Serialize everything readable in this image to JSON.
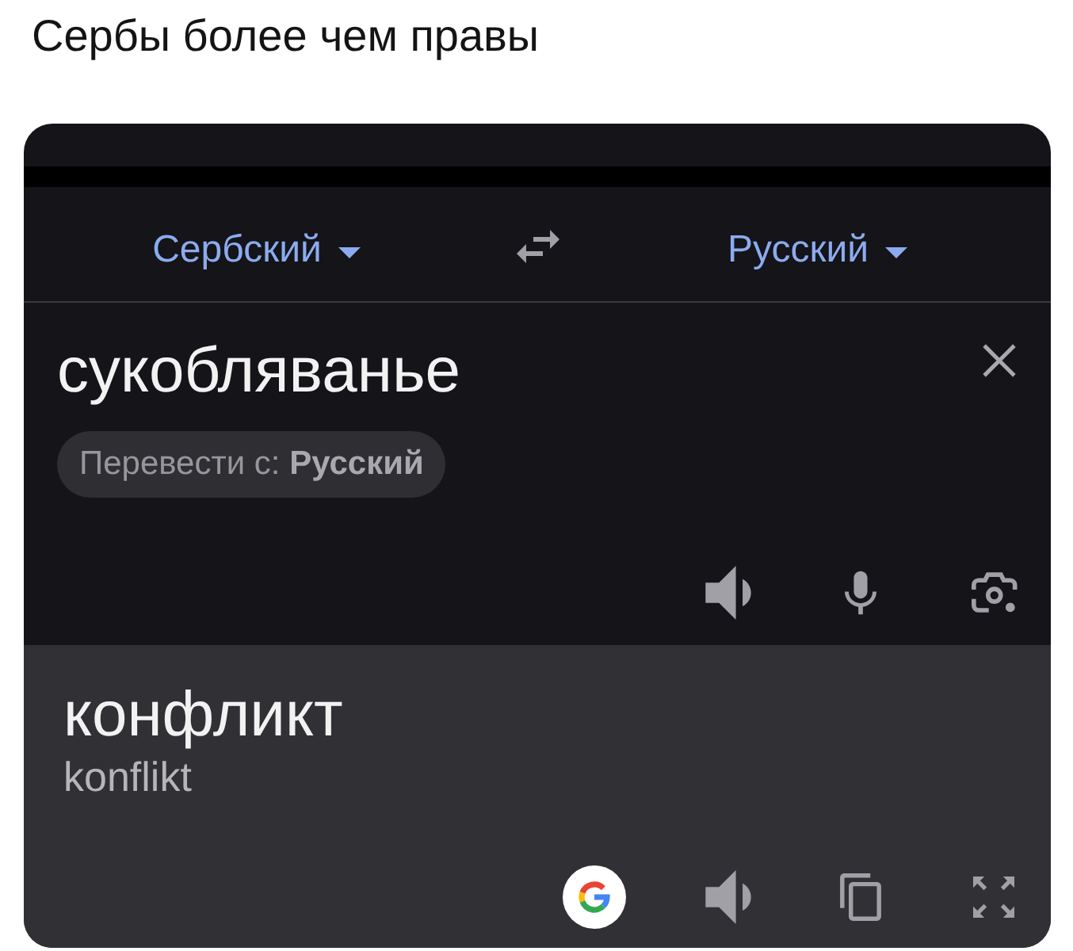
{
  "post": {
    "caption": "Сербы более чем правы"
  },
  "translator": {
    "source_language": "Сербский",
    "target_language": "Русский",
    "input": {
      "value": "сукобляванье",
      "detect_suggestion": "Перевести с: **Русский**"
    },
    "output": {
      "translation": "конфликт",
      "transliteration": "konflikt"
    }
  }
}
